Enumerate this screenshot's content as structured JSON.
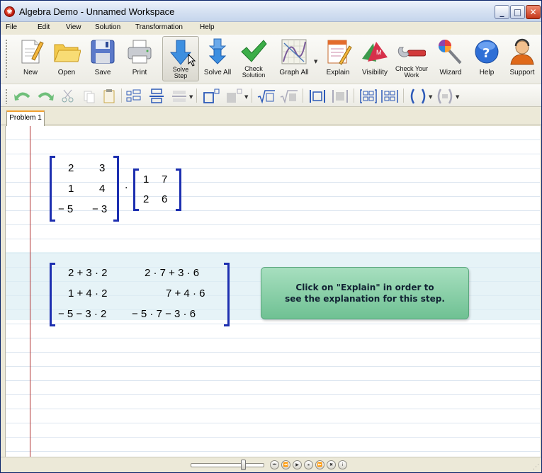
{
  "window": {
    "title": "Algebra Demo - Unnamed Workspace",
    "icon_glyph": "❀",
    "min_glyph": "_",
    "max_glyph": "□",
    "close_glyph": "✕"
  },
  "menu": [
    "File",
    "Edit",
    "View",
    "Solution",
    "Transformation",
    "Help"
  ],
  "toolbar": {
    "new": "New",
    "open": "Open",
    "save": "Save",
    "print": "Print",
    "solve_step": "Solve Step",
    "solve_all": "Solve All",
    "check_solution": "Check Solution",
    "graph_all": "Graph All",
    "explain": "Explain",
    "visibility": "Visibility",
    "check_your_work": "Check Your Work",
    "wizard": "Wizard",
    "help": "Help",
    "support": "Support"
  },
  "tabs": [
    "Problem 1"
  ],
  "problem": {
    "matrix_a": [
      [
        "2",
        "3"
      ],
      [
        "1",
        "4"
      ],
      [
        "− 5",
        "− 3"
      ]
    ],
    "operator": "·",
    "matrix_b": [
      [
        "1",
        "7"
      ],
      [
        "2",
        "6"
      ]
    ],
    "step_matrix": [
      [
        "2 + 3 · 2",
        "2 · 7 + 3 · 6"
      ],
      [
        "1 + 4 · 2",
        "7 + 4 · 6"
      ],
      [
        "− 5 − 3 · 2",
        "− 5 · 7 − 3 · 6"
      ]
    ]
  },
  "hint": {
    "line1": "Click on \"Explain\" in order to",
    "line2": "see the explanation for this step."
  },
  "playback": [
    "⏮",
    "⏪",
    "▶",
    "⏸",
    "⏩",
    "✖",
    "i"
  ],
  "colors": {
    "bracket": "#1d2fb0",
    "hint_bg": "#8fd1ac",
    "margin_line": "#b03030"
  }
}
